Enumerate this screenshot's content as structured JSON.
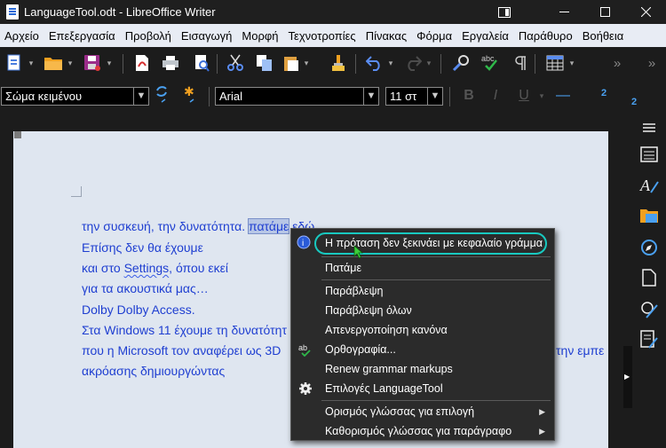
{
  "window": {
    "title": "LanguageTool.odt - LibreOffice Writer",
    "icons": [
      "app-icon",
      "sidebar-toggle-icon",
      "minimize-icon",
      "maximize-icon",
      "close-icon"
    ]
  },
  "menubar": {
    "items": [
      "Αρχείο",
      "Επεξεργασία",
      "Προβολή",
      "Εισαγωγή",
      "Μορφή",
      "Τεχνοτροπίες",
      "Πίνακας",
      "Φόρμα",
      "Εργαλεία",
      "Παράθυρο",
      "Βοήθεια"
    ]
  },
  "toolbar2": {
    "paragraph_style": "Σώμα κειμένου",
    "font_name": "Arial",
    "font_size": "11 στ"
  },
  "document": {
    "lines": [
      [
        "την συσκευή, την δυνατότητα. ",
        "πατάμε",
        " εδώ"
      ],
      [
        "Επίσης δεν θα έχουμε"
      ],
      [
        "και στο ",
        "Settings",
        ", όπου εκεί"
      ],
      [
        "για τα ακουστικά μας…"
      ],
      [
        "Dolby Dolby Access."
      ],
      [
        "Στα Windows 11 έχουμε τη δυνατότητ"
      ],
      [
        " που η Microsoft τον αναφέρει ως 3D",
        "την εμπε"
      ],
      [
        "ακρόασης δημιουργώντας"
      ]
    ]
  },
  "context_menu": {
    "items": [
      {
        "label": "Η πρόταση δεν ξεκινάει με κεφαλαίο γράμμα",
        "icon": "languagetool-info-icon",
        "highlighted": true
      },
      {
        "label": "Πατάμε"
      },
      {
        "label": "Παράβλεψη"
      },
      {
        "label": "Παράβλεψη όλων"
      },
      {
        "label": "Απενεργοποίηση κανόνα"
      },
      {
        "label": "Ορθογραφία...",
        "icon": "spelling-icon"
      },
      {
        "label": "Renew grammar markups"
      },
      {
        "label": "Επιλογές LanguageTool",
        "icon": "gear-icon"
      },
      {
        "label": "Ορισμός γλώσσας για επιλογή",
        "submenu": true
      },
      {
        "label": "Καθορισμός γλώσσας για παράγραφο",
        "submenu": true
      }
    ]
  },
  "colors": {
    "doc_text": "#1f3fd1",
    "page_bg": "#dfe6f0",
    "highlight_ring": "#18c9c0",
    "menu_bg": "#2b2b2b"
  }
}
